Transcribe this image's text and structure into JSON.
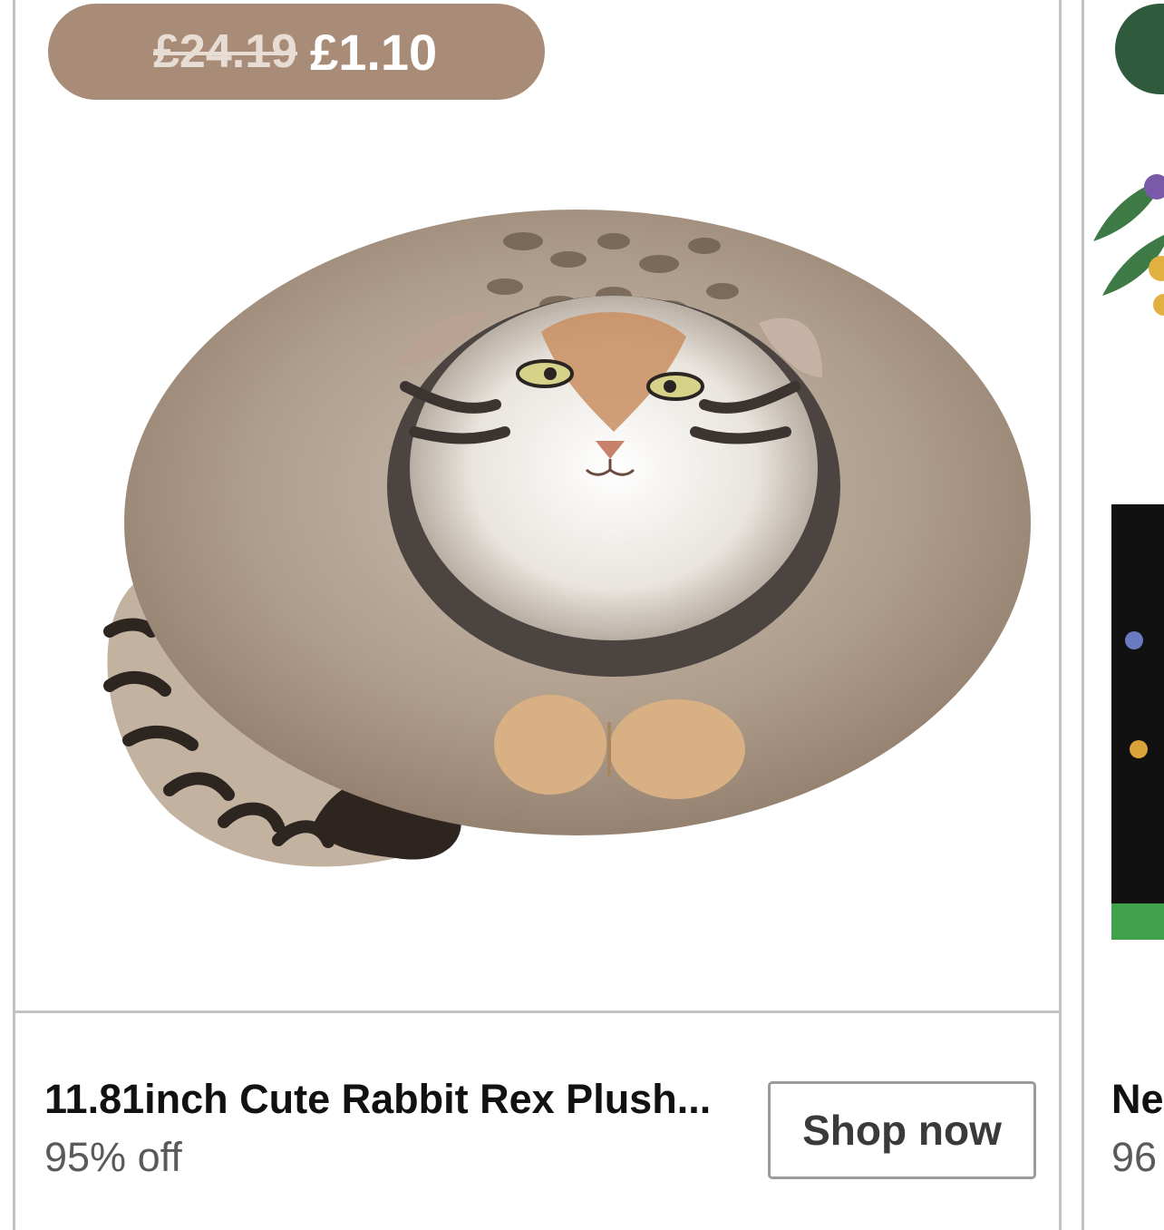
{
  "product": {
    "original_price": "£24.19",
    "sale_price": "£1.10",
    "title": "11.81inch Cute Rabbit Rex Plush...",
    "discount": "95% off",
    "cta_label": "Shop now",
    "image_alt": "Pallas cat round plush toy"
  },
  "next_product": {
    "title": "Ne",
    "discount": "96"
  },
  "colors": {
    "price_pill": "#a98c77",
    "next_pill": "#2f5a3c",
    "card_border": "#c2c2c2"
  }
}
